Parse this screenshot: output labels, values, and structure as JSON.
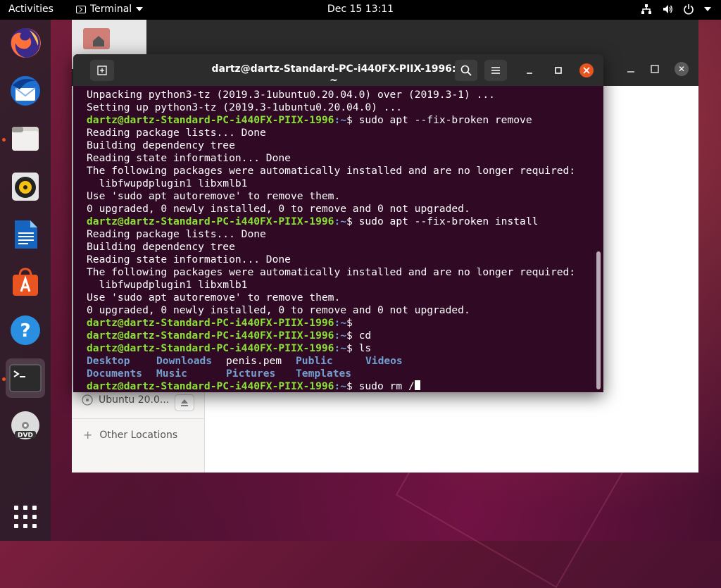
{
  "topbar": {
    "activities": "Activities",
    "app_menu": "Terminal",
    "clock": "Dec 15  13:11"
  },
  "dock": {
    "items": [
      "firefox-icon",
      "thunderbird-icon",
      "files-icon",
      "rhythmbox-icon",
      "libreoffice-writer-icon",
      "software-icon",
      "help-icon",
      "terminal-icon",
      "dvd-icon",
      "show-apps-icon"
    ]
  },
  "file_manager": {
    "mount_label": "Ubuntu 20.0...",
    "other_locations": "Other Locations"
  },
  "terminal": {
    "title": "dartz@dartz-Standard-PC-i440FX-PIIX-1996: ~",
    "prompt_user": "dartz@dartz-Standard-PC-i440FX-PIIX-1996",
    "lines": {
      "l1": "Unpacking python3-tz (2019.3-1ubuntu0.20.04.0) over (2019.3-1) ...",
      "l2": "Setting up python3-tz (2019.3-1ubuntu0.20.04.0) ...",
      "cmd1": "$ sudo apt --fix-broken remove",
      "l4": "Reading package lists... Done",
      "l5": "Building dependency tree",
      "l6": "Reading state information... Done",
      "l7": "The following packages were automatically installed and are no longer required:",
      "l8": "  libfwupdplugin1 libxmlb1",
      "l9": "Use 'sudo apt autoremove' to remove them.",
      "l10": "0 upgraded, 0 newly installed, 0 to remove and 0 not upgraded.",
      "cmd2": "$ sudo apt --fix-broken install",
      "l12": "Reading package lists... Done",
      "l13": "Building dependency tree",
      "l14": "Reading state information... Done",
      "l15": "The following packages were automatically installed and are no longer required:",
      "l16": "  libfwupdplugin1 libxmlb1",
      "l17": "Use 'sudo apt autoremove' to remove them.",
      "l18": "0 upgraded, 0 newly installed, 0 to remove and 0 not upgraded.",
      "cmd3": "$",
      "cmd4": "$ cd",
      "cmd5": "$ ls",
      "cmd6": "$ sudo rm /"
    },
    "tilde": ":~",
    "ls": {
      "row1": [
        "Desktop",
        "Downloads",
        "penis.pem",
        "Public",
        "Videos"
      ],
      "row2": [
        "Documents",
        "Music",
        "Pictures",
        "Templates"
      ]
    }
  },
  "colors": {
    "terminal_bg": "#300a24",
    "prompt_green": "#8ae234",
    "dir_blue": "#729fcf",
    "accent_orange": "#e95420"
  }
}
